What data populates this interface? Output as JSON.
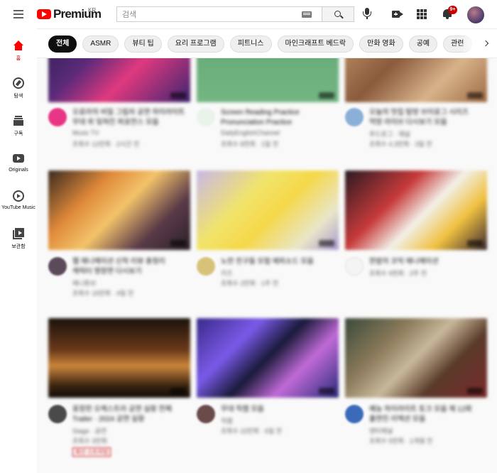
{
  "header": {
    "logo_text": "Premium",
    "country": "KR",
    "search_placeholder": "검색",
    "notification_count": "9+"
  },
  "sidebar": {
    "items": [
      {
        "label": "홈",
        "icon": "home-icon"
      },
      {
        "label": "탐색",
        "icon": "explore-icon"
      },
      {
        "label": "구독",
        "icon": "subscriptions-icon"
      },
      {
        "label": "Originals",
        "icon": "originals-icon"
      },
      {
        "label": "YouTube Music",
        "icon": "youtube-music-icon"
      },
      {
        "label": "보관함",
        "icon": "library-icon"
      }
    ]
  },
  "chips": [
    "전체",
    "ASMR",
    "뷰티 팁",
    "요리 프로그램",
    "피트니스",
    "마인크래프트 베드락",
    "만화 영화",
    "공예",
    "관련"
  ],
  "videos": [
    {
      "title": "오로라의 비밀 그림자 공연 하이라이트 영상",
      "title2": "무대 위 잊혀진 퍼포먼스 모음",
      "channel": "Music TV",
      "stats": "조회수 12만회 · 2시간 전"
    },
    {
      "title": "Screen Reading Practice",
      "title2": "Pronunciation Practice",
      "channel": "DailyEnglishChannel",
      "stats": "조회수 8천회 · 1일 전"
    },
    {
      "title": "오늘의 맛집 탐방 브이로그 시리즈",
      "title2": "먹방 라이브 다시보기 모음",
      "channel": "푸드로그 · 채널",
      "stats": "조회수 4.3만회 · 3일 전"
    },
    {
      "title": "웹 애니메이션 신작 리뷰 총정리",
      "title2": "캐릭터 명장면 다시보기",
      "channel": "애니튜브",
      "stats": "조회수 15만회 · 4일 전"
    },
    {
      "title": "노란 친구들 모험 에피소드 모음",
      "title2": "",
      "channel": "키즈",
      "stats": "조회수 2만회 · 1주 전"
    },
    {
      "title": "한밤의 코믹 애니메이션",
      "title2": "",
      "channel": "",
      "stats": "조회수 9천회 · 2주 전"
    },
    {
      "title": "웅장한 오케스트라 공연 실황 전체",
      "title2": "Trailer · 2024 공연 실황",
      "channel": "Stage · 공연",
      "stats": "조회수 3만회",
      "badge": "최신 스트리밍"
    },
    {
      "title": "무대 직캠 모음",
      "title2": "",
      "channel": "직캠",
      "stats": "조회수 22만회 · 6일 전"
    },
    {
      "title": "예능 하이라이트 토크 모음 제 12화",
      "title2": "출연진 리액션 모음",
      "channel": "엔터채널",
      "stats": "조회수 5만회 · 1개월 전"
    }
  ],
  "colors": {
    "brand": "#ff0000",
    "chip_active": "#0f0f0f",
    "badge": "#cc0000",
    "background": "#f9f9f9"
  }
}
